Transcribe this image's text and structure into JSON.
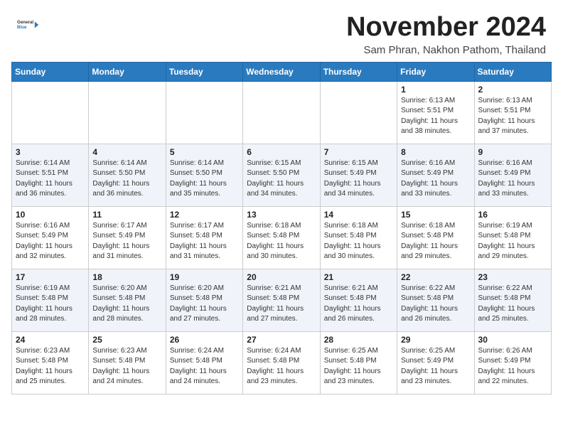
{
  "header": {
    "logo_line1": "General",
    "logo_line2": "Blue",
    "month": "November 2024",
    "location": "Sam Phran, Nakhon Pathom, Thailand"
  },
  "weekdays": [
    "Sunday",
    "Monday",
    "Tuesday",
    "Wednesday",
    "Thursday",
    "Friday",
    "Saturday"
  ],
  "weeks": [
    [
      {
        "day": "",
        "info": ""
      },
      {
        "day": "",
        "info": ""
      },
      {
        "day": "",
        "info": ""
      },
      {
        "day": "",
        "info": ""
      },
      {
        "day": "",
        "info": ""
      },
      {
        "day": "1",
        "info": "Sunrise: 6:13 AM\nSunset: 5:51 PM\nDaylight: 11 hours\nand 38 minutes."
      },
      {
        "day": "2",
        "info": "Sunrise: 6:13 AM\nSunset: 5:51 PM\nDaylight: 11 hours\nand 37 minutes."
      }
    ],
    [
      {
        "day": "3",
        "info": "Sunrise: 6:14 AM\nSunset: 5:51 PM\nDaylight: 11 hours\nand 36 minutes."
      },
      {
        "day": "4",
        "info": "Sunrise: 6:14 AM\nSunset: 5:50 PM\nDaylight: 11 hours\nand 36 minutes."
      },
      {
        "day": "5",
        "info": "Sunrise: 6:14 AM\nSunset: 5:50 PM\nDaylight: 11 hours\nand 35 minutes."
      },
      {
        "day": "6",
        "info": "Sunrise: 6:15 AM\nSunset: 5:50 PM\nDaylight: 11 hours\nand 34 minutes."
      },
      {
        "day": "7",
        "info": "Sunrise: 6:15 AM\nSunset: 5:49 PM\nDaylight: 11 hours\nand 34 minutes."
      },
      {
        "day": "8",
        "info": "Sunrise: 6:16 AM\nSunset: 5:49 PM\nDaylight: 11 hours\nand 33 minutes."
      },
      {
        "day": "9",
        "info": "Sunrise: 6:16 AM\nSunset: 5:49 PM\nDaylight: 11 hours\nand 33 minutes."
      }
    ],
    [
      {
        "day": "10",
        "info": "Sunrise: 6:16 AM\nSunset: 5:49 PM\nDaylight: 11 hours\nand 32 minutes."
      },
      {
        "day": "11",
        "info": "Sunrise: 6:17 AM\nSunset: 5:49 PM\nDaylight: 11 hours\nand 31 minutes."
      },
      {
        "day": "12",
        "info": "Sunrise: 6:17 AM\nSunset: 5:48 PM\nDaylight: 11 hours\nand 31 minutes."
      },
      {
        "day": "13",
        "info": "Sunrise: 6:18 AM\nSunset: 5:48 PM\nDaylight: 11 hours\nand 30 minutes."
      },
      {
        "day": "14",
        "info": "Sunrise: 6:18 AM\nSunset: 5:48 PM\nDaylight: 11 hours\nand 30 minutes."
      },
      {
        "day": "15",
        "info": "Sunrise: 6:18 AM\nSunset: 5:48 PM\nDaylight: 11 hours\nand 29 minutes."
      },
      {
        "day": "16",
        "info": "Sunrise: 6:19 AM\nSunset: 5:48 PM\nDaylight: 11 hours\nand 29 minutes."
      }
    ],
    [
      {
        "day": "17",
        "info": "Sunrise: 6:19 AM\nSunset: 5:48 PM\nDaylight: 11 hours\nand 28 minutes."
      },
      {
        "day": "18",
        "info": "Sunrise: 6:20 AM\nSunset: 5:48 PM\nDaylight: 11 hours\nand 28 minutes."
      },
      {
        "day": "19",
        "info": "Sunrise: 6:20 AM\nSunset: 5:48 PM\nDaylight: 11 hours\nand 27 minutes."
      },
      {
        "day": "20",
        "info": "Sunrise: 6:21 AM\nSunset: 5:48 PM\nDaylight: 11 hours\nand 27 minutes."
      },
      {
        "day": "21",
        "info": "Sunrise: 6:21 AM\nSunset: 5:48 PM\nDaylight: 11 hours\nand 26 minutes."
      },
      {
        "day": "22",
        "info": "Sunrise: 6:22 AM\nSunset: 5:48 PM\nDaylight: 11 hours\nand 26 minutes."
      },
      {
        "day": "23",
        "info": "Sunrise: 6:22 AM\nSunset: 5:48 PM\nDaylight: 11 hours\nand 25 minutes."
      }
    ],
    [
      {
        "day": "24",
        "info": "Sunrise: 6:23 AM\nSunset: 5:48 PM\nDaylight: 11 hours\nand 25 minutes."
      },
      {
        "day": "25",
        "info": "Sunrise: 6:23 AM\nSunset: 5:48 PM\nDaylight: 11 hours\nand 24 minutes."
      },
      {
        "day": "26",
        "info": "Sunrise: 6:24 AM\nSunset: 5:48 PM\nDaylight: 11 hours\nand 24 minutes."
      },
      {
        "day": "27",
        "info": "Sunrise: 6:24 AM\nSunset: 5:48 PM\nDaylight: 11 hours\nand 23 minutes."
      },
      {
        "day": "28",
        "info": "Sunrise: 6:25 AM\nSunset: 5:48 PM\nDaylight: 11 hours\nand 23 minutes."
      },
      {
        "day": "29",
        "info": "Sunrise: 6:25 AM\nSunset: 5:49 PM\nDaylight: 11 hours\nand 23 minutes."
      },
      {
        "day": "30",
        "info": "Sunrise: 6:26 AM\nSunset: 5:49 PM\nDaylight: 11 hours\nand 22 minutes."
      }
    ]
  ]
}
